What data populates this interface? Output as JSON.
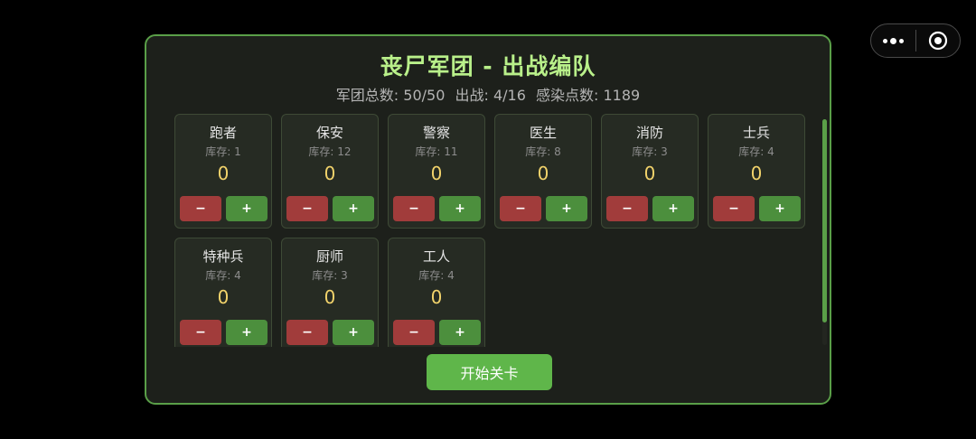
{
  "capsule": {
    "menu_icon": "more-dots-icon",
    "close_icon": "target-circle-icon"
  },
  "panel": {
    "title": "丧尸军团 - 出战编队",
    "stats": {
      "total": "军团总数: 50/50",
      "deployed": "出战: 4/16",
      "infection_points": "感染点数: 1189"
    },
    "units": [
      {
        "name": "跑者",
        "stock": "库存: 1",
        "count": "0"
      },
      {
        "name": "保安",
        "stock": "库存: 12",
        "count": "0"
      },
      {
        "name": "警察",
        "stock": "库存: 11",
        "count": "0"
      },
      {
        "name": "医生",
        "stock": "库存: 8",
        "count": "0"
      },
      {
        "name": "消防",
        "stock": "库存: 3",
        "count": "0"
      },
      {
        "name": "士兵",
        "stock": "库存: 4",
        "count": "0"
      },
      {
        "name": "特种兵",
        "stock": "库存: 4",
        "count": "0"
      },
      {
        "name": "厨师",
        "stock": "库存: 3",
        "count": "0"
      },
      {
        "name": "工人",
        "stock": "库存: 4",
        "count": "0"
      }
    ],
    "minus_label": "−",
    "plus_label": "+",
    "start_label": "开始关卡",
    "scroll_fraction_visible": 0.9
  },
  "colors": {
    "accent": "#5fb64a",
    "title": "#b9f08a",
    "count": "#f2d36b",
    "minus": "#a13c3b",
    "plus": "#4c8f3d"
  }
}
